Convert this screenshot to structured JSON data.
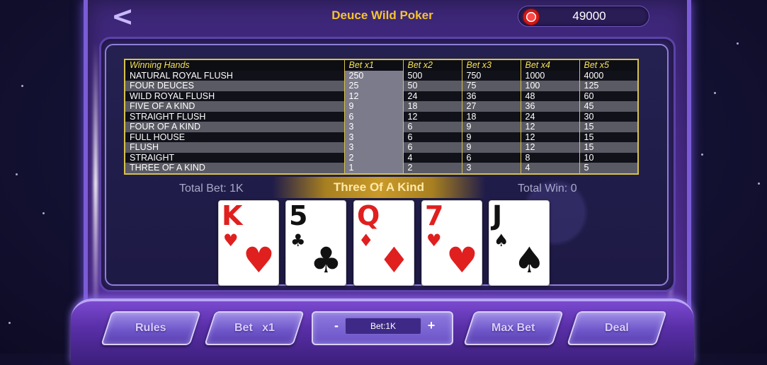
{
  "header": {
    "back_icon": "chevron-left-icon",
    "back_glyph": "<",
    "title": "Deuce Wild Poker",
    "balance": "49000",
    "balance_icon": "poker-chip-icon"
  },
  "paytable": {
    "headers": [
      "Winning Hands",
      "Bet x1",
      "Bet x2",
      "Bet x3",
      "Bet x4",
      "Bet x5"
    ],
    "rows": [
      [
        "NATURAL ROYAL FLUSH",
        "250",
        "500",
        "750",
        "1000",
        "4000"
      ],
      [
        "FOUR DEUCES",
        "25",
        "50",
        "75",
        "100",
        "125"
      ],
      [
        "WILD ROYAL FLUSH",
        "12",
        "24",
        "36",
        "48",
        "60"
      ],
      [
        "FIVE OF A KIND",
        "9",
        "18",
        "27",
        "36",
        "45"
      ],
      [
        "STRAIGHT FLUSH",
        "6",
        "12",
        "18",
        "24",
        "30"
      ],
      [
        "FOUR OF A KIND",
        "3",
        "6",
        "9",
        "12",
        "15"
      ],
      [
        "FULL HOUSE",
        "3",
        "6",
        "9",
        "12",
        "15"
      ],
      [
        "FLUSH",
        "3",
        "6",
        "9",
        "12",
        "15"
      ],
      [
        "STRAIGHT",
        "2",
        "4",
        "6",
        "8",
        "10"
      ],
      [
        "THREE OF A KIND",
        "1",
        "2",
        "3",
        "4",
        "5"
      ]
    ],
    "highlighted_column": "Bet x1"
  },
  "status": {
    "total_bet": "Total Bet: 1K",
    "result": "Three Of A Kind",
    "total_win": "Total Win: 0"
  },
  "cards": [
    {
      "rank": "K",
      "suit": "♥",
      "suit_name": "hearts",
      "color": "red"
    },
    {
      "rank": "5",
      "suit": "♣",
      "suit_name": "clubs",
      "color": "black"
    },
    {
      "rank": "Q",
      "suit": "♦",
      "suit_name": "diamonds",
      "color": "red"
    },
    {
      "rank": "7",
      "suit": "♥",
      "suit_name": "hearts",
      "color": "red"
    },
    {
      "rank": "J",
      "suit": "♠",
      "suit_name": "spades",
      "color": "black"
    }
  ],
  "controls": {
    "rules_label": "Rules",
    "bet_label": "Bet   x1",
    "bet_minus": "-",
    "bet_amount": "Bet:1K",
    "bet_plus": "+",
    "max_bet_label": "Max Bet",
    "deal_label": "Deal"
  },
  "colors": {
    "title": "#f5c330",
    "paytable_border": "#d7c24a",
    "cabinet": "#4a2b8c",
    "card_red": "#e01f1f"
  }
}
